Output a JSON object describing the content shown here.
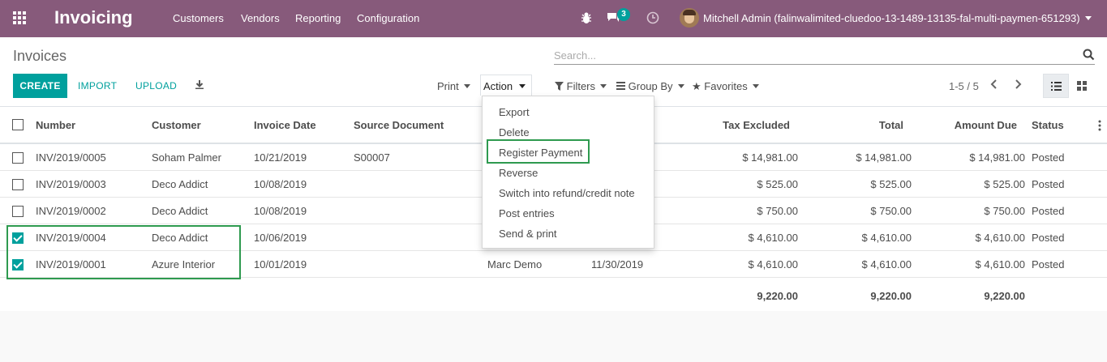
{
  "navbar": {
    "app_name": "Invoicing",
    "menus": [
      "Customers",
      "Vendors",
      "Reporting",
      "Configuration"
    ],
    "messages_count": "3",
    "user": "Mitchell Admin (falinwalimited-cluedoo-13-1489-13135-fal-multi-paymen-651293)",
    "color": "#875a7b"
  },
  "control_panel": {
    "breadcrumb": "Invoices",
    "search_placeholder": "Search...",
    "create_label": "CREATE",
    "import_label": "IMPORT",
    "upload_label": "UPLOAD",
    "print_label": "Print",
    "action_label": "Action",
    "filters_label": "Filters",
    "groupby_label": "Group By",
    "favorites_label": "Favorites",
    "pager": "1-5 / 5",
    "accent": "#00a09d"
  },
  "action_menu": {
    "items": [
      "Export",
      "Delete",
      "Register Payment",
      "Reverse",
      "Switch into refund/credit note",
      "Post entries",
      "Send & print"
    ]
  },
  "table": {
    "columns": [
      "Number",
      "Customer",
      "Invoice Date",
      "Source Document",
      "Tax Excluded",
      "Total",
      "Amount Due",
      "Status"
    ],
    "rows": [
      {
        "number": "INV/2019/0005",
        "customer": "Soham Palmer",
        "date": "10/21/2019",
        "source": "S00007",
        "salesperson": "",
        "due": "",
        "tax_excl": "$ 14,981.00",
        "total": "$ 14,981.00",
        "amount_due": "$ 14,981.00",
        "status": "Posted",
        "checked": false
      },
      {
        "number": "INV/2019/0003",
        "customer": "Deco Addict",
        "date": "10/08/2019",
        "source": "",
        "salesperson": "",
        "due": "",
        "tax_excl": "$ 525.00",
        "total": "$ 525.00",
        "amount_due": "$ 525.00",
        "status": "Posted",
        "checked": false
      },
      {
        "number": "INV/2019/0002",
        "customer": "Deco Addict",
        "date": "10/08/2019",
        "source": "",
        "salesperson": "",
        "due": "",
        "tax_excl": "$ 750.00",
        "total": "$ 750.00",
        "amount_due": "$ 750.00",
        "status": "Posted",
        "checked": false
      },
      {
        "number": "INV/2019/0004",
        "customer": "Deco Addict",
        "date": "10/06/2019",
        "source": "",
        "salesperson": "",
        "due": "",
        "tax_excl": "$ 4,610.00",
        "total": "$ 4,610.00",
        "amount_due": "$ 4,610.00",
        "status": "Posted",
        "checked": true
      },
      {
        "number": "INV/2019/0001",
        "customer": "Azure Interior",
        "date": "10/01/2019",
        "source": "",
        "salesperson": "Marc Demo",
        "due": "11/30/2019",
        "tax_excl": "$ 4,610.00",
        "total": "$ 4,610.00",
        "amount_due": "$ 4,610.00",
        "status": "Posted",
        "checked": true
      }
    ],
    "totals": {
      "tax_excl": "9,220.00",
      "total": "9,220.00",
      "amount_due": "9,220.00"
    }
  }
}
